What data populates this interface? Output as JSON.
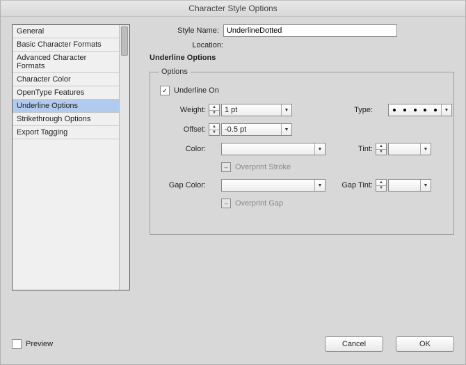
{
  "window": {
    "title": "Character Style Options"
  },
  "sidebar": {
    "items": [
      {
        "label": "General"
      },
      {
        "label": "Basic Character Formats"
      },
      {
        "label": "Advanced Character Formats"
      },
      {
        "label": "Character Color"
      },
      {
        "label": "OpenType Features"
      },
      {
        "label": "Underline Options"
      },
      {
        "label": "Strikethrough Options"
      },
      {
        "label": "Export Tagging"
      }
    ],
    "selected_index": 5
  },
  "header": {
    "style_name_label": "Style Name:",
    "style_name_value": "UnderlineDotted",
    "location_label": "Location:",
    "section_title": "Underline Options"
  },
  "options": {
    "legend": "Options",
    "underline_on_label": "Underline On",
    "underline_on_checked": true,
    "weight_label": "Weight:",
    "weight_value": "1 pt",
    "type_label": "Type:",
    "offset_label": "Offset:",
    "offset_value": "-0.5 pt",
    "color_label": "Color:",
    "tint_label": "Tint:",
    "tint_value": "",
    "overprint_stroke_label": "Overprint Stroke",
    "gap_color_label": "Gap Color:",
    "gap_tint_label": "Gap Tint:",
    "gap_tint_value": "",
    "overprint_gap_label": "Overprint Gap"
  },
  "footer": {
    "preview_label": "Preview",
    "cancel_label": "Cancel",
    "ok_label": "OK"
  }
}
